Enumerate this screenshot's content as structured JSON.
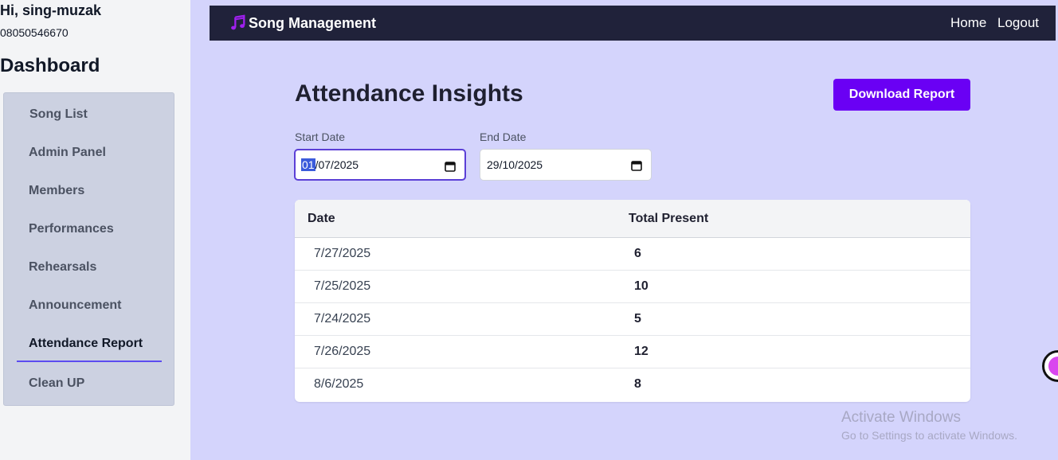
{
  "user": {
    "greeting": "Hi, sing-muzak",
    "phone": "08050546670"
  },
  "sidebar": {
    "title": "Dashboard",
    "items": [
      {
        "label": "Song List"
      },
      {
        "label": "Admin Panel"
      },
      {
        "label": "Members"
      },
      {
        "label": "Performances"
      },
      {
        "label": "Rehearsals"
      },
      {
        "label": "Announcement"
      },
      {
        "label": "Attendance Report",
        "active": true
      },
      {
        "label": "Clean UP"
      }
    ]
  },
  "topbar": {
    "brand": "Song Management",
    "brand_icon": "music-note-icon",
    "nav": [
      {
        "label": "Home"
      },
      {
        "label": "Logout"
      }
    ]
  },
  "page": {
    "title": "Attendance Insights",
    "download_label": "Download Report"
  },
  "filters": {
    "start": {
      "label": "Start Date",
      "day": "01",
      "rest": "/07/2025"
    },
    "end": {
      "label": "End Date",
      "value": "29/10/2025"
    }
  },
  "table": {
    "headers": [
      "Date",
      "Total Present"
    ],
    "rows": [
      {
        "date": "7/27/2025",
        "count": "6"
      },
      {
        "date": "7/25/2025",
        "count": "10"
      },
      {
        "date": "7/24/2025",
        "count": "5"
      },
      {
        "date": "7/26/2025",
        "count": "12"
      },
      {
        "date": "8/6/2025",
        "count": "8"
      }
    ]
  },
  "watermark": {
    "line1": "Activate Windows",
    "line2": "Go to Settings to activate Windows."
  },
  "colors": {
    "accent": "#6a00f4",
    "navbar": "#20223a",
    "background": "#d4d4fc",
    "sidebar_menu": "#ccd1e1"
  }
}
